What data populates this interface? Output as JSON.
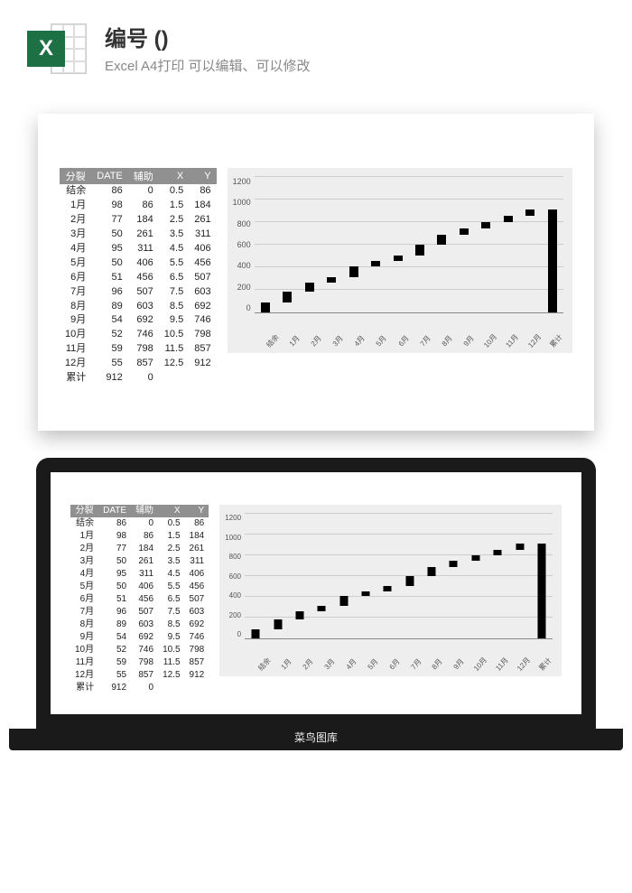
{
  "header": {
    "icon_letter": "X",
    "title": "编号 ()",
    "subtitle": "Excel A4打印 可以编辑、可以修改"
  },
  "laptop_base_text": "菜鸟图库",
  "table": {
    "headers": [
      "分裂",
      "DATE",
      "辅助",
      "X",
      "Y"
    ],
    "rows": [
      [
        "结余",
        "86",
        "0",
        "0.5",
        "86"
      ],
      [
        "1月",
        "98",
        "86",
        "1.5",
        "184"
      ],
      [
        "2月",
        "77",
        "184",
        "2.5",
        "261"
      ],
      [
        "3月",
        "50",
        "261",
        "3.5",
        "311"
      ],
      [
        "4月",
        "95",
        "311",
        "4.5",
        "406"
      ],
      [
        "5月",
        "50",
        "406",
        "5.5",
        "456"
      ],
      [
        "6月",
        "51",
        "456",
        "6.5",
        "507"
      ],
      [
        "7月",
        "96",
        "507",
        "7.5",
        "603"
      ],
      [
        "8月",
        "89",
        "603",
        "8.5",
        "692"
      ],
      [
        "9月",
        "54",
        "692",
        "9.5",
        "746"
      ],
      [
        "10月",
        "52",
        "746",
        "10.5",
        "798"
      ],
      [
        "11月",
        "59",
        "798",
        "11.5",
        "857"
      ],
      [
        "12月",
        "55",
        "857",
        "12.5",
        "912"
      ],
      [
        "累计",
        "912",
        "0",
        "",
        ""
      ]
    ]
  },
  "chart_data": {
    "type": "bar",
    "title": "",
    "xlabel": "",
    "ylabel": "",
    "ylim": [
      0,
      1200
    ],
    "yticks": [
      0,
      200,
      400,
      600,
      800,
      1000,
      1200
    ],
    "categories": [
      "结余",
      "1月",
      "2月",
      "3月",
      "4月",
      "5月",
      "6月",
      "7月",
      "8月",
      "9月",
      "10月",
      "11月",
      "12月",
      "累计"
    ],
    "series": [
      {
        "name": "辅助",
        "values": [
          0,
          86,
          184,
          261,
          311,
          406,
          456,
          507,
          603,
          692,
          746,
          798,
          857,
          0
        ],
        "color": "transparent"
      },
      {
        "name": "DATE",
        "values": [
          86,
          98,
          77,
          50,
          95,
          50,
          51,
          96,
          89,
          54,
          52,
          59,
          55,
          912
        ],
        "color": "#000000"
      }
    ]
  }
}
